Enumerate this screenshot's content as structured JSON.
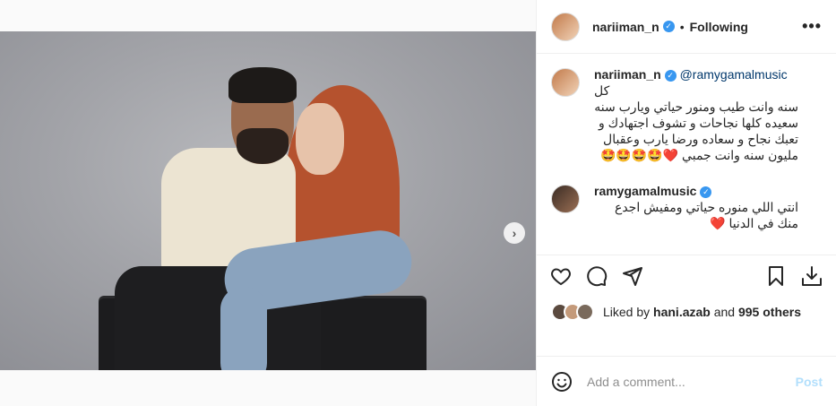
{
  "post": {
    "image_alt": "",
    "slide_count": 2,
    "active_slide": 1
  },
  "header": {
    "username": "nariiman_n",
    "separator": "•",
    "follow_label": "Following",
    "more_label": "•••"
  },
  "caption": {
    "username": "nariiman_n",
    "mention": "@ramygamalmusic",
    "text_line1": "كل",
    "text": "سنه وانت طيب ومنور حياتي ويارب سنه سعيده كلها نجاحات و تشوف اجتهادك و تعبك نجاح و سعاده ورضا يارب وعقبال مليون سنه وانت جمبي ❤️🤩🤩🤩🤩"
  },
  "comments": [
    {
      "username": "ramygamalmusic",
      "text": "انتي اللي منوره حياتي ومفيش اجدع منك في الدنيا ❤️"
    }
  ],
  "likes": {
    "prefix": "Liked by",
    "user": "hani.azab",
    "and": "and",
    "others": "995 others"
  },
  "add_comment": {
    "placeholder": "Add a comment...",
    "post_label": "Post"
  },
  "icons": {
    "verified": "verified-badge-icon",
    "emoji": "emoji-icon",
    "like": "heart-icon",
    "comment": "comment-icon",
    "share": "paper-plane-icon",
    "save": "bookmark-icon",
    "download": "download-icon",
    "next": "chevron-right-icon"
  },
  "colors": {
    "verified": "#3897f0",
    "post_disabled": "#b2dffc",
    "mention": "#00376b"
  }
}
